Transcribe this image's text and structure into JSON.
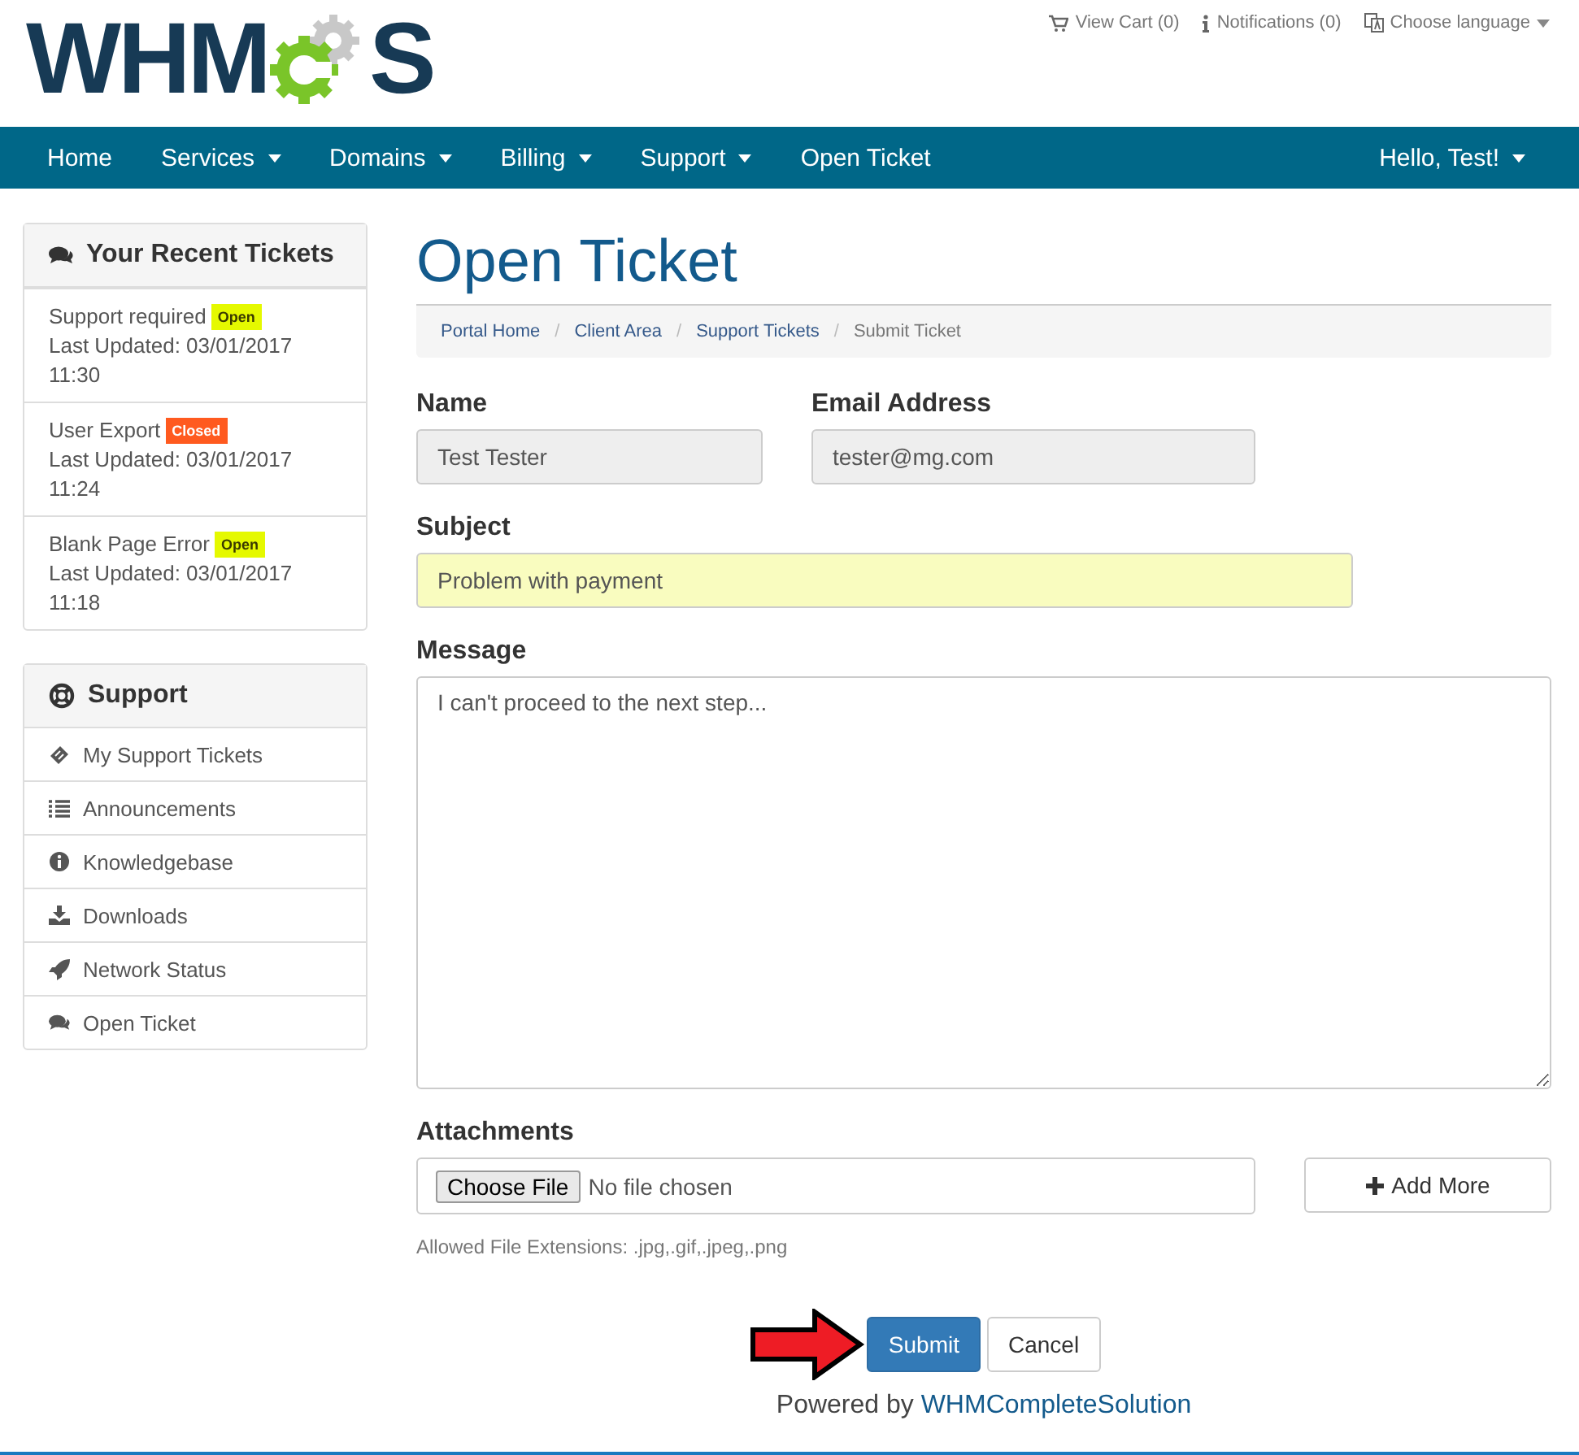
{
  "header": {
    "logo": {
      "left": "WHM",
      "right": "S"
    },
    "links": [
      {
        "kind": "cart",
        "label": "View Cart (0)",
        "dropdown": false
      },
      {
        "kind": "info",
        "label": "Notifications (0)",
        "dropdown": false
      },
      {
        "kind": "language",
        "label": "Choose language",
        "dropdown": true
      }
    ]
  },
  "nav": {
    "items": [
      {
        "label": "Home",
        "dropdown": false
      },
      {
        "label": "Services",
        "dropdown": true
      },
      {
        "label": "Domains",
        "dropdown": true
      },
      {
        "label": "Billing",
        "dropdown": true
      },
      {
        "label": "Support",
        "dropdown": true
      },
      {
        "label": "Open Ticket",
        "dropdown": false
      }
    ],
    "user": {
      "label": "Hello, Test!",
      "dropdown": true
    }
  },
  "sidebar": {
    "recent_tickets": {
      "title": "Your Recent Tickets",
      "tickets": [
        {
          "subject": "Support required",
          "status": "Open",
          "color": "#e5f900",
          "updated": "Last Updated: 03/01/2017 11:30"
        },
        {
          "subject": "User Export",
          "status": "Closed",
          "color": "#ff5a1f",
          "updated": "Last Updated: 03/01/2017 11:24"
        },
        {
          "subject": "Blank Page Error",
          "status": "Open",
          "color": "#e5f900",
          "updated": "Last Updated: 03/01/2017 11:18"
        }
      ]
    },
    "support": {
      "title": "Support",
      "items": [
        {
          "kind": "ticket",
          "label": "My Support Tickets"
        },
        {
          "kind": "list",
          "label": "Announcements"
        },
        {
          "kind": "info",
          "label": "Knowledgebase"
        },
        {
          "kind": "download",
          "label": "Downloads"
        },
        {
          "kind": "rocket",
          "label": "Network Status"
        },
        {
          "kind": "comments",
          "label": "Open Ticket"
        }
      ]
    }
  },
  "main": {
    "title": "Open Ticket",
    "breadcrumb": [
      {
        "label": "Portal Home",
        "current": false
      },
      {
        "separator": "/",
        "label": "Client Area",
        "current": false
      },
      {
        "separator": "/",
        "label": "Support Tickets",
        "current": false
      },
      {
        "separator": "/",
        "label": "Submit Ticket",
        "current": true
      }
    ],
    "fields": [
      {
        "label": "Name",
        "value": "Test Tester",
        "disabled": true,
        "highlighted": false
      },
      {
        "label": "Email Address",
        "value": "tester@mg.com",
        "disabled": true,
        "highlighted": false
      },
      {
        "label": "Subject",
        "value": "Problem with payment",
        "disabled": false,
        "highlighted": true
      }
    ],
    "message": {
      "label": "Message",
      "value": "I can't proceed to the next step..."
    },
    "attachments": {
      "label": "Attachments",
      "choose_button": "Choose File",
      "file_status": "No file chosen",
      "add_button": "Add More",
      "help": "Allowed File Extensions: .jpg,.gif,.jpeg,.png"
    },
    "buttons": [
      {
        "label": "Submit",
        "kind": "primary"
      },
      {
        "label": "Cancel",
        "kind": "default"
      }
    ]
  },
  "footer": {
    "prefix": "Powered by",
    "link": "WHMCompleteSolution"
  }
}
